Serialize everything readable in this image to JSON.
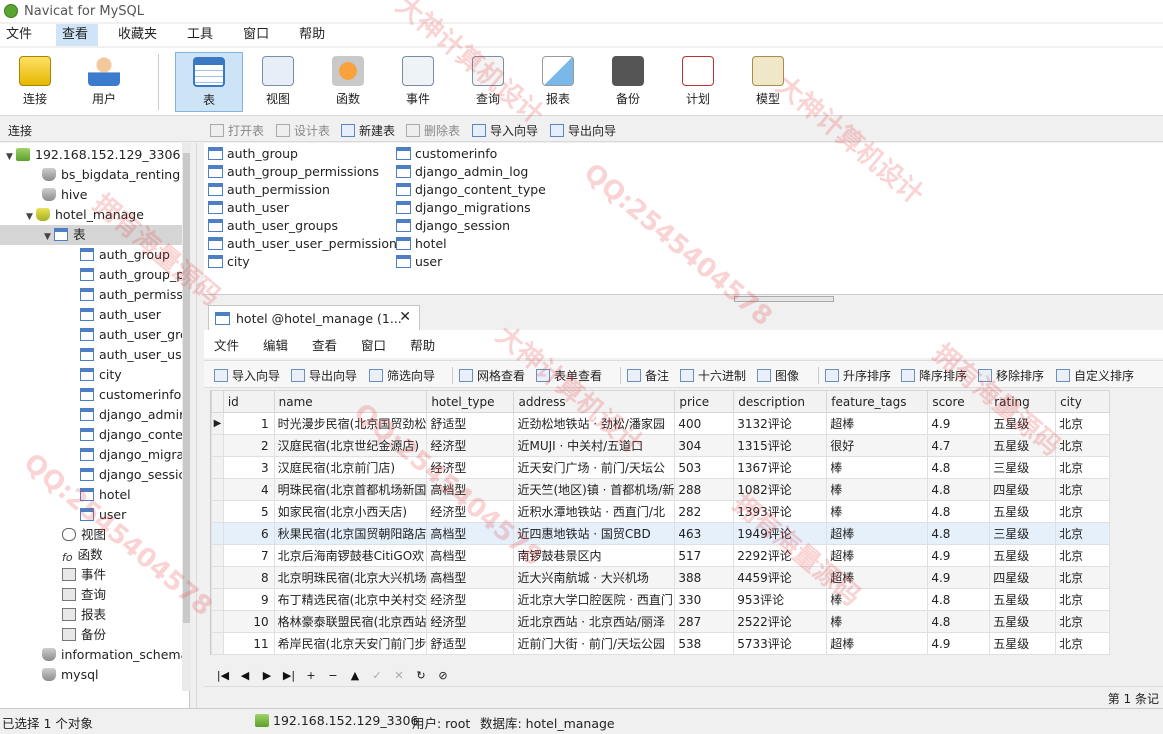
{
  "window": {
    "title": "Navicat for MySQL"
  },
  "menu": [
    "文件",
    "查看",
    "收藏夹",
    "工具",
    "窗口",
    "帮助"
  ],
  "toolbar": [
    {
      "label": "连接",
      "icon": "connect-icon"
    },
    {
      "label": "用户",
      "icon": "user-icon"
    },
    {
      "label": "表",
      "icon": "table-icon"
    },
    {
      "label": "视图",
      "icon": "view-icon"
    },
    {
      "label": "函数",
      "icon": "function-icon"
    },
    {
      "label": "事件",
      "icon": "event-icon"
    },
    {
      "label": "查询",
      "icon": "query-icon"
    },
    {
      "label": "报表",
      "icon": "report-icon"
    },
    {
      "label": "备份",
      "icon": "backup-icon"
    },
    {
      "label": "计划",
      "icon": "schedule-icon"
    },
    {
      "label": "模型",
      "icon": "model-icon"
    }
  ],
  "connection_bar": {
    "title": "连接",
    "actions": [
      "打开表",
      "设计表",
      "新建表",
      "删除表",
      "导入向导",
      "导出向导"
    ]
  },
  "tree": {
    "server": "192.168.152.129_3306",
    "databases": [
      "bs_bigdata_renting",
      "hive",
      "hotel_manage"
    ],
    "tables_folder": "表",
    "tables": [
      "auth_group",
      "auth_group_p",
      "auth_permissi",
      "auth_user",
      "auth_user_grc",
      "auth_user_use",
      "city",
      "customerinfo",
      "django_admir",
      "django_conte",
      "django_migra",
      "django_sessic",
      "hotel",
      "user"
    ],
    "other_nodes": [
      "视图",
      "函数",
      "事件",
      "查询",
      "报表",
      "备份"
    ],
    "more_databases": [
      "information_schema",
      "mysql"
    ]
  },
  "objects": {
    "col1": [
      "auth_group",
      "auth_group_permissions",
      "auth_permission",
      "auth_user",
      "auth_user_groups",
      "auth_user_user_permissions",
      "city"
    ],
    "col2": [
      "customerinfo",
      "django_admin_log",
      "django_content_type",
      "django_migrations",
      "django_session",
      "hotel",
      "user"
    ]
  },
  "tab": {
    "label": "hotel @hotel_manage (1...",
    "close": "✕"
  },
  "inner_menu": [
    "文件",
    "编辑",
    "查看",
    "窗口",
    "帮助"
  ],
  "inner_toolbar": [
    "导入向导",
    "导出向导",
    "筛选向导",
    "网格查看",
    "表单查看",
    "备注",
    "十六进制",
    "图像",
    "升序排序",
    "降序排序",
    "移除排序",
    "自定义排序"
  ],
  "table": {
    "columns": [
      "id",
      "name",
      "hotel_type",
      "address",
      "price",
      "description",
      "feature_tags",
      "score",
      "rating",
      "city"
    ],
    "rows": [
      [
        "1",
        "时光漫步民宿(北京国贸劲松",
        "舒适型",
        "近劲松地铁站 · 劲松/潘家园",
        "400",
        "3132评论",
        "超棒",
        "4.9",
        "五星级",
        "北京"
      ],
      [
        "2",
        "汉庭民宿(北京世纪金源店)",
        "经济型",
        "近MUJI · 中关村/五道口",
        "304",
        "1315评论",
        "很好",
        "4.7",
        "五星级",
        "北京"
      ],
      [
        "3",
        "汉庭民宿(北京前门店)",
        "经济型",
        "近天安门广场 · 前门/天坛公",
        "503",
        "1367评论",
        "棒",
        "4.8",
        "三星级",
        "北京"
      ],
      [
        "4",
        "明珠民宿(北京首都机场新国",
        "高档型",
        "近天竺(地区)镇 · 首都机场/新",
        "288",
        "1082评论",
        "棒",
        "4.8",
        "四星级",
        "北京"
      ],
      [
        "5",
        "如家民宿(北京小西天店)",
        "经济型",
        "近积水潭地铁站 · 西直门/北",
        "282",
        "1393评论",
        "棒",
        "4.8",
        "五星级",
        "北京"
      ],
      [
        "6",
        "秋果民宿(北京国贸朝阳路店",
        "高档型",
        "近四惠地铁站 · 国贸CBD",
        "463",
        "1949评论",
        "超棒",
        "4.8",
        "三星级",
        "北京"
      ],
      [
        "7",
        "北京后海南锣鼓巷CitiGO欢",
        "高档型",
        "南锣鼓巷景区内",
        "517",
        "2292评论",
        "超棒",
        "4.9",
        "五星级",
        "北京"
      ],
      [
        "8",
        "北京明珠民宿(北京大兴机场",
        "高档型",
        "近大兴南航城 · 大兴机场",
        "388",
        "4459评论",
        "超棒",
        "4.9",
        "四星级",
        "北京"
      ],
      [
        "9",
        "布丁精选民宿(北京中关村交",
        "经济型",
        "近北京大学口腔医院 · 西直门",
        "330",
        "953评论",
        "棒",
        "4.8",
        "五星级",
        "北京"
      ],
      [
        "10",
        "格林豪泰联盟民宿(北京西站",
        "经济型",
        "近北京西站 · 北京西站/丽泽",
        "287",
        "2522评论",
        "棒",
        "4.8",
        "五星级",
        "北京"
      ],
      [
        "11",
        "希岸民宿(北京天安门前门步",
        "舒适型",
        "近前门大街 · 前门/天坛公园",
        "538",
        "5733评论",
        "超棒",
        "4.9",
        "五星级",
        "北京"
      ]
    ]
  },
  "navigator": [
    "|◀",
    "◀",
    "▶",
    "▶|",
    "+",
    "−",
    "▲",
    "✓",
    "✕",
    "↻",
    "⊘"
  ],
  "page_info": "第 1 条记",
  "status": {
    "selection": "已选择 1 个对象",
    "server": "192.168.152.129_3306",
    "user": "用户: root",
    "database": "数据库: hotel_manage"
  },
  "watermarks": [
    "大神计算机设计",
    "拥有海量源码",
    "QQ:2545404578",
    "大神计算机设计",
    "QQ:2545404578",
    "拥有海量源码",
    "QQ:2545404578",
    "大神计算机设计",
    "拥有海量源码"
  ]
}
